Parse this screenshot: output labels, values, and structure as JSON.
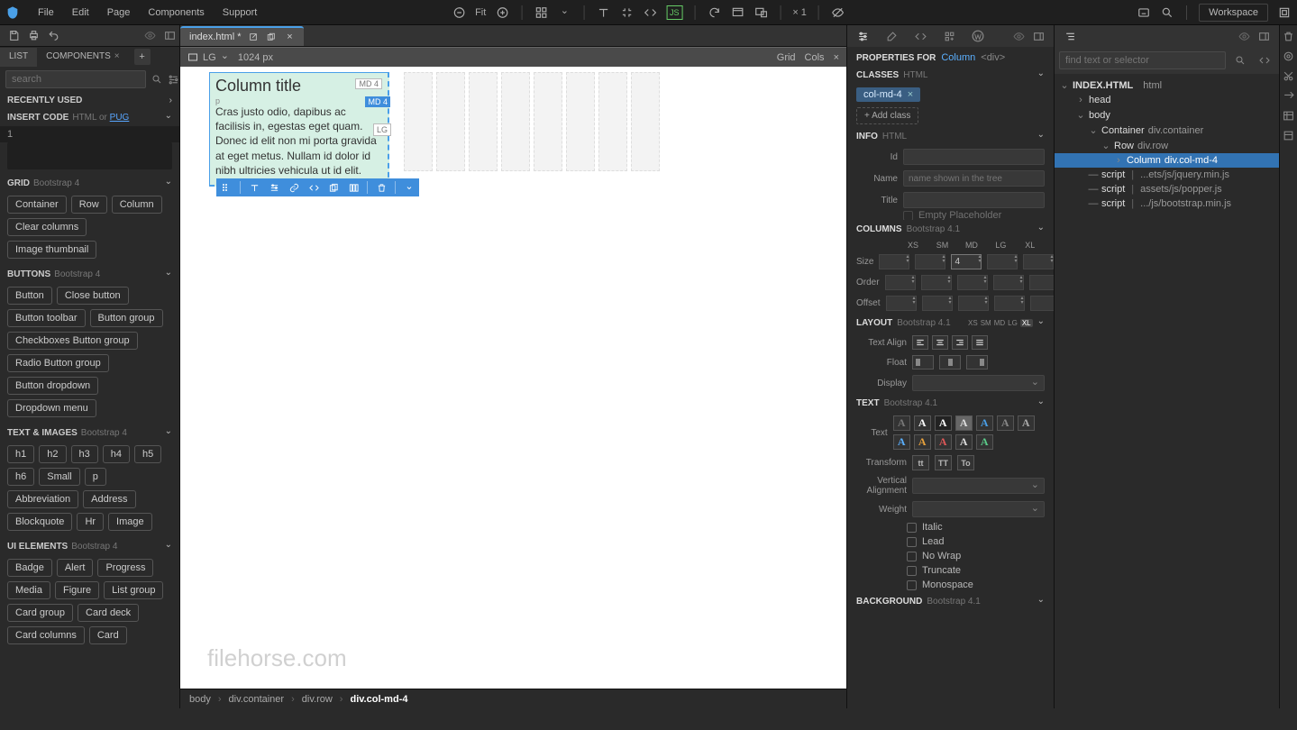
{
  "topbar": {
    "menus": [
      "File",
      "Edit",
      "Page",
      "Components",
      "Support"
    ],
    "fit": "Fit",
    "zoom_mult": "× 1",
    "workspace": "Workspace"
  },
  "file_tab": {
    "name": "index.html *"
  },
  "viewport_bar": {
    "bp": "LG",
    "size": "1024 px",
    "grid": "Grid",
    "cols": "Cols"
  },
  "canvas": {
    "title": "Column title",
    "p_label": "p",
    "paragraph": "Cras justo odio, dapibus ac facilisis in, egestas eget quam. Donec id elit non mi porta gravida at eget metus. Nullam id dolor id nibh ultricies vehicula ut id elit.",
    "badge_md_top": "MD 4",
    "badge_md_hover": "MD 4",
    "badge_lg": "LG"
  },
  "crumbs": [
    "body",
    "div.container",
    "div.row",
    "div.col-md-4"
  ],
  "left": {
    "tabs": {
      "list": "LIST",
      "components": "COMPONENTS"
    },
    "search_placeholder": "search",
    "sec_recent": "RECENTLY USED",
    "sec_insert": "INSERT CODE",
    "insert_sub1": "HTML or ",
    "insert_sub2": "PUG",
    "code_line": "1",
    "sec_grid": "GRID",
    "grid_sub": "Bootstrap 4",
    "pills_grid": [
      "Container",
      "Row",
      "Column",
      "Clear columns",
      "Image thumbnail"
    ],
    "sec_buttons": "BUTTONS",
    "buttons_sub": "Bootstrap 4",
    "pills_buttons": [
      "Button",
      "Close button",
      "Button toolbar",
      "Button group",
      "Checkboxes Button group",
      "Radio Button group",
      "Button dropdown",
      "Dropdown menu"
    ],
    "sec_text": "TEXT & IMAGES",
    "text_sub": "Bootstrap 4",
    "pills_text": [
      "h1",
      "h2",
      "h3",
      "h4",
      "h5",
      "h6",
      "Small",
      "p",
      "Abbreviation",
      "Address",
      "Blockquote",
      "Hr",
      "Image"
    ],
    "sec_ui": "UI ELEMENTS",
    "ui_sub": "Bootstrap 4",
    "pills_ui": [
      "Badge",
      "Alert",
      "Progress",
      "Media",
      "Figure",
      "List group",
      "Card group",
      "Card deck",
      "Card columns",
      "Card"
    ]
  },
  "right": {
    "properties_for": "PROPERTIES FOR",
    "sel_name": "Column",
    "sel_tag": "<div>",
    "sec_classes": "CLASSES",
    "classes_sub": "HTML",
    "class_chip": "col-md-4",
    "add_class": "Add class",
    "sec_info": "INFO",
    "info_sub": "HTML",
    "id_lbl": "Id",
    "name_lbl": "Name",
    "name_ph": "name shown in the tree",
    "title_lbl": "Title",
    "empty_ph": "Empty Placeholder",
    "sec_columns": "COLUMNS",
    "columns_sub": "Bootstrap 4.1",
    "bps": [
      "XS",
      "SM",
      "MD",
      "LG",
      "XL"
    ],
    "size_lbl": "Size",
    "size_md": "4",
    "order_lbl": "Order",
    "offset_lbl": "Offset",
    "sec_layout": "LAYOUT",
    "layout_sub": "Bootstrap 4.1",
    "layout_bps": [
      "XS",
      "SM",
      "MD",
      "LG",
      "XL"
    ],
    "align_lbl": "Text Align",
    "float_lbl": "Float",
    "display_lbl": "Display",
    "sec_text": "TEXT",
    "text_sub": "Bootstrap 4.1",
    "text_lbl": "Text",
    "transform_lbl": "Transform",
    "tts": [
      "tt",
      "TT",
      "To"
    ],
    "valign_lbl": "Vertical Alignment",
    "weight_lbl": "Weight",
    "checks": [
      "Italic",
      "Lead",
      "No Wrap",
      "Truncate",
      "Monospace"
    ],
    "sec_bg": "BACKGROUND",
    "bg_sub": "Bootstrap 4.1"
  },
  "tree": {
    "search_placeholder": "find text or selector",
    "root": "INDEX.HTML",
    "root_sel": "html",
    "nodes": [
      {
        "indent": 1,
        "car": "›",
        "name": "head",
        "sel": ""
      },
      {
        "indent": 1,
        "car": "⌄",
        "name": "body",
        "sel": ""
      },
      {
        "indent": 2,
        "car": "⌄",
        "name": "Container",
        "sel": "div.container"
      },
      {
        "indent": 3,
        "car": "⌄",
        "name": "Row",
        "sel": "div.row"
      },
      {
        "indent": 4,
        "car": "›",
        "name": "Column",
        "sel": "div.col-md-4",
        "selected": true
      },
      {
        "indent": 2,
        "car": "—",
        "name": "script",
        "sel": "...ets/js/jquery.min.js",
        "pipe": true
      },
      {
        "indent": 2,
        "car": "—",
        "name": "script",
        "sel": "assets/js/popper.js",
        "pipe": true
      },
      {
        "indent": 2,
        "car": "—",
        "name": "script",
        "sel": ".../js/bootstrap.min.js",
        "pipe": true
      }
    ]
  },
  "watermark": "filehorse.com"
}
